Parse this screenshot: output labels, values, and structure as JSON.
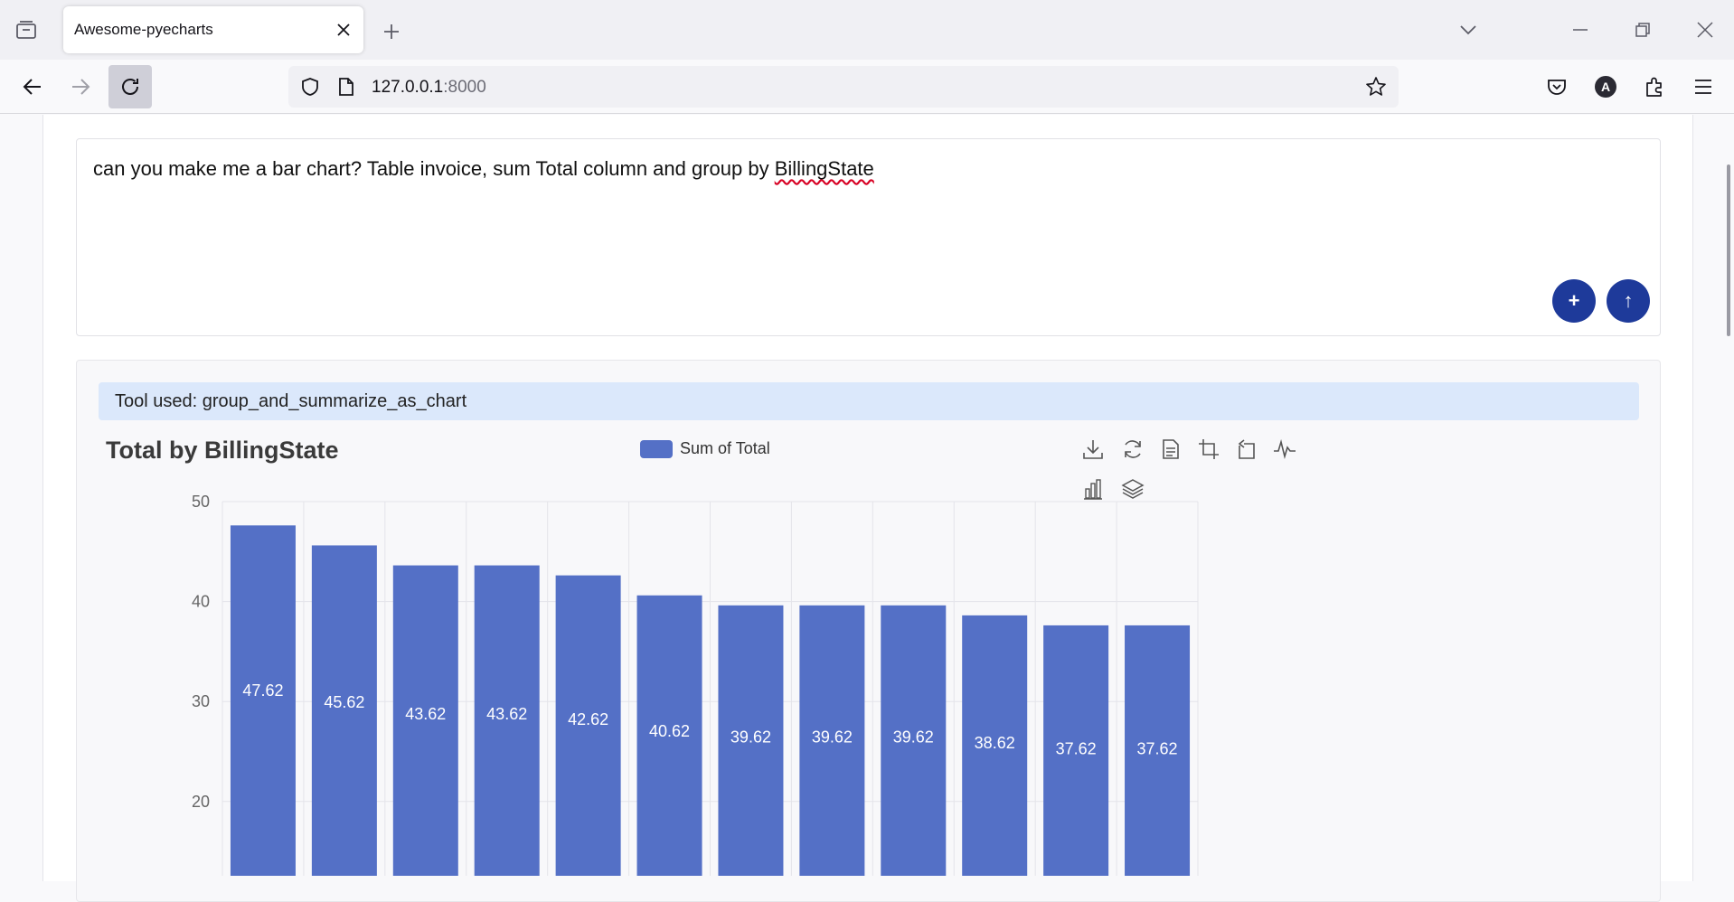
{
  "browser": {
    "tab_title": "Awesome-pyecharts",
    "url_host": "127.0.0.1",
    "url_port": ":8000"
  },
  "icons": {
    "tab_list": "tab-list-icon",
    "close": "close-icon",
    "new_tab": "plus-icon",
    "back": "arrow-left-icon",
    "forward": "arrow-right-icon",
    "reload": "reload-icon",
    "shield": "shield-icon",
    "page": "page-icon",
    "star": "star-icon",
    "pocket": "pocket-icon",
    "account": "account-icon",
    "extensions": "puzzle-icon",
    "menu": "hamburger-icon"
  },
  "prompt": {
    "text_before": "can you make me a bar chart? Table invoice, sum Total column and group by ",
    "text_spell": "BillingState",
    "add_label": "+",
    "submit_label": "↑"
  },
  "result": {
    "tool_used": "Tool used: group_and_summarize_as_chart"
  },
  "toolbox": [
    "download-icon",
    "refresh-icon",
    "data-view-icon",
    "zoom-icon",
    "zoom-reset-icon",
    "line-chart-icon",
    "bar-chart-icon",
    "stack-icon"
  ],
  "colors": {
    "bar": "#5470c6",
    "accent_button": "#1e3a9a",
    "banner": "#dbe8fb"
  },
  "chart_data": {
    "type": "bar",
    "title": "Total by BillingState",
    "legend": "Sum of Total",
    "legend_position": "top",
    "ylim": [
      0,
      50
    ],
    "yticks": [
      20,
      30,
      40,
      50
    ],
    "grid": true,
    "categories": [
      "",
      "",
      "",
      "",
      "",
      "",
      "",
      "",
      "",
      "",
      "",
      ""
    ],
    "series": [
      {
        "name": "Sum of Total",
        "values": [
          47.62,
          45.62,
          43.62,
          43.62,
          42.62,
          40.62,
          39.62,
          39.62,
          39.62,
          38.62,
          37.62,
          37.62
        ]
      }
    ]
  }
}
